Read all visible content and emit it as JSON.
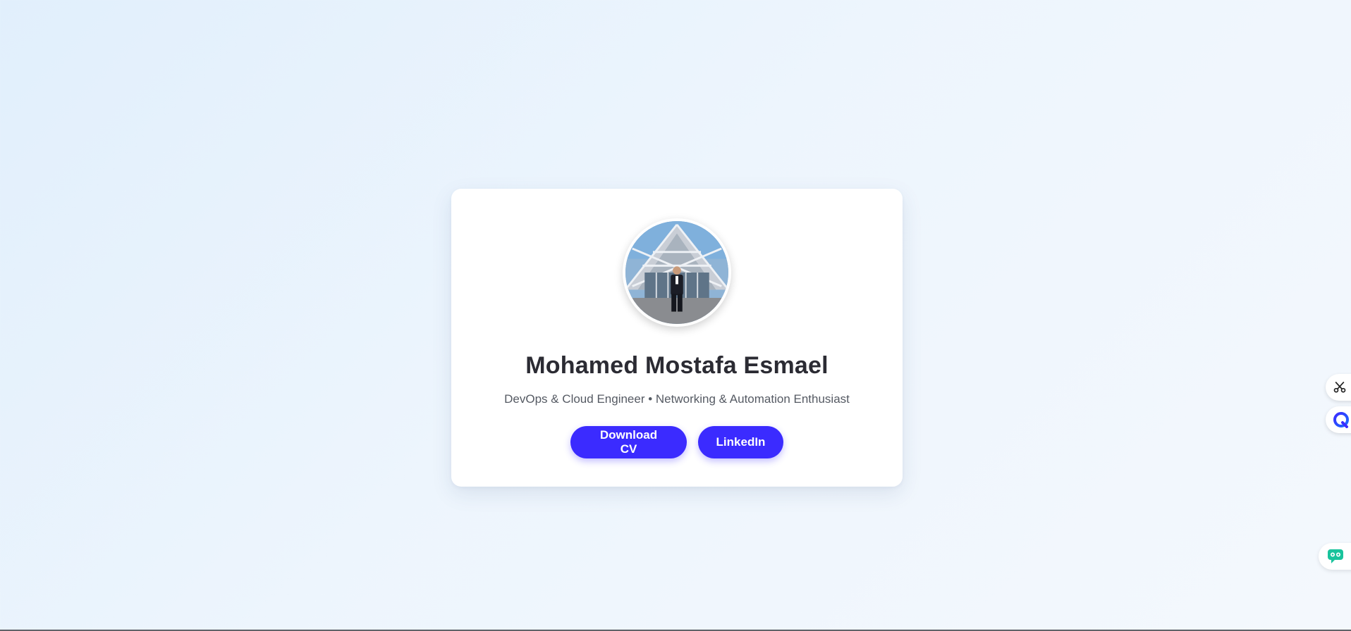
{
  "profile": {
    "name": "Mohamed Mostafa Esmael",
    "subtitle": "DevOps & Cloud Engineer • Networking & Automation Enthusiast",
    "avatar_alt": "profile-photo"
  },
  "buttons": {
    "download_cv": "Download CV",
    "linkedin": "LinkedIn"
  },
  "icons": {
    "scissors": "scissors-icon",
    "q_logo": "q-logo-icon",
    "chat": "chat-bot-icon"
  },
  "colors": {
    "accent": "#3b2bff",
    "name_text": "#2b2b33",
    "subtitle_text": "#555a63",
    "chat_widget": "#19c39c"
  }
}
